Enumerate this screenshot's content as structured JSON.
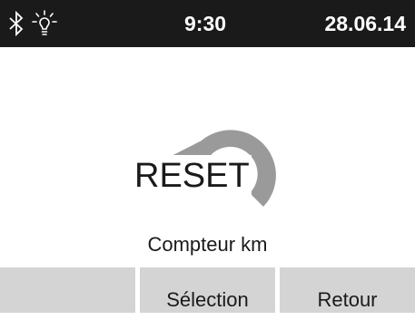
{
  "status_bar": {
    "time": "9:30",
    "date": "28.06.14",
    "icons": [
      "bluetooth-icon",
      "light-bulb-icon"
    ]
  },
  "main": {
    "reset_label": "RESET",
    "counter_label": "Compteur km"
  },
  "softkeys": [
    {
      "label": ""
    },
    {
      "label": "Sélection"
    },
    {
      "label": "Retour"
    }
  ],
  "colors": {
    "status_bar_bg": "#1a1a1a",
    "arrow": "#9a9a9a",
    "softkey_bg": "#d4d4d4"
  }
}
